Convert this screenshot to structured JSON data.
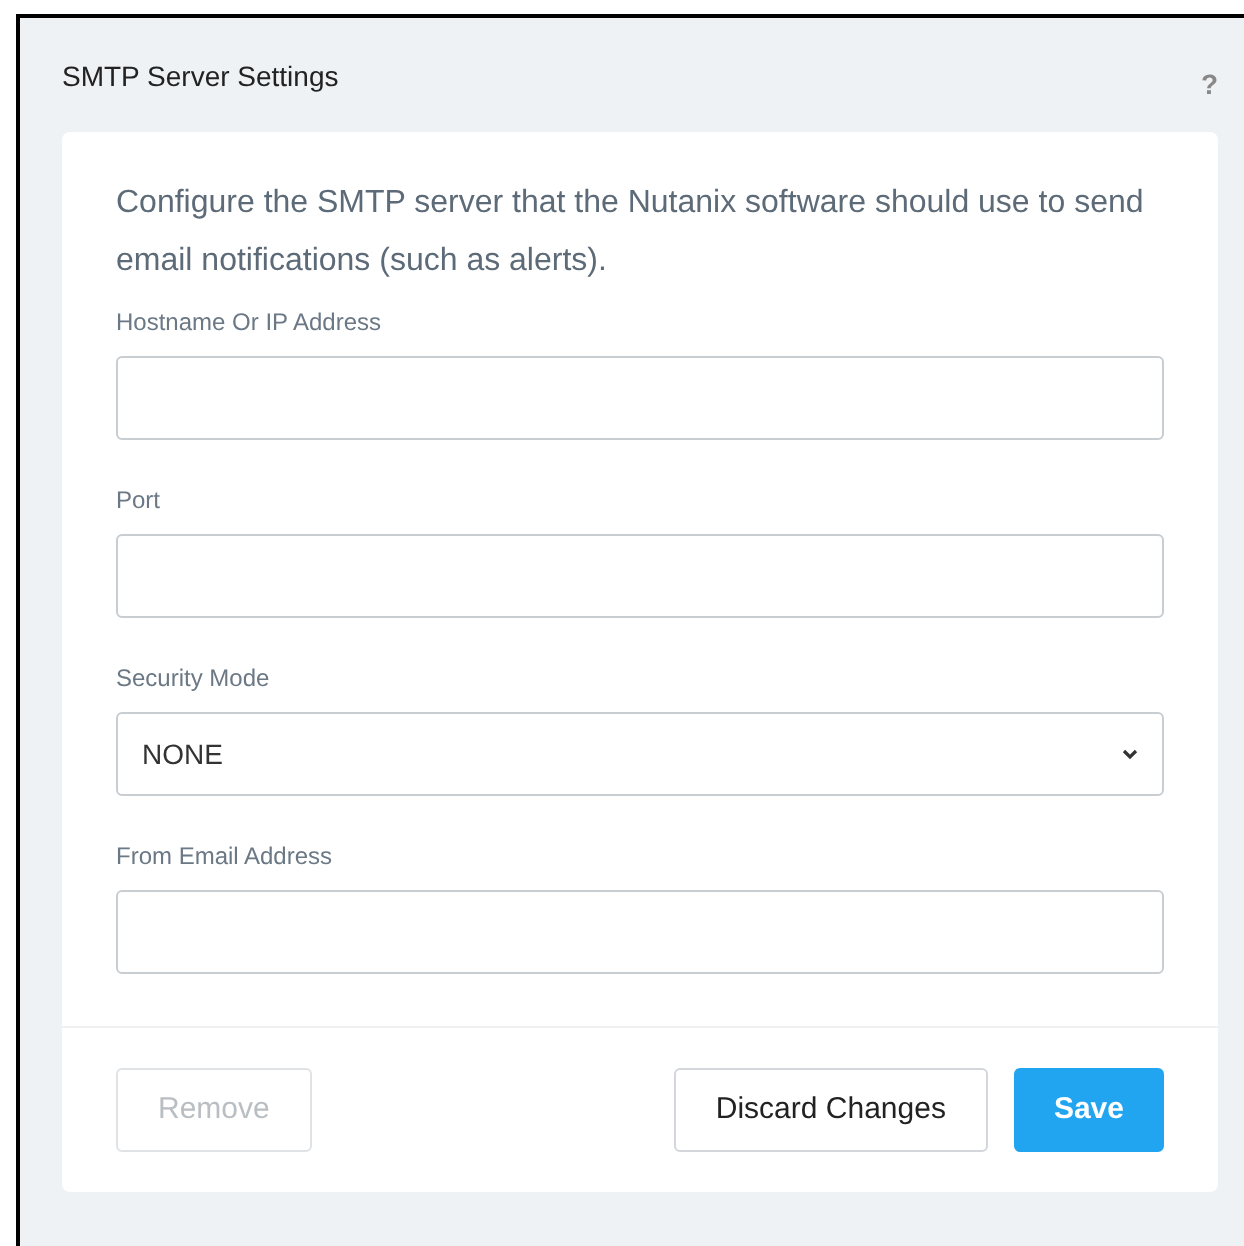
{
  "panel": {
    "title": "SMTP Server Settings",
    "help": "?"
  },
  "description": "Configure the SMTP server that the Nutanix software should use to send email notifications (such as alerts).",
  "fields": [
    {
      "kind": "text",
      "label": "Hostname Or IP Address"
    },
    {
      "kind": "text",
      "label": "Port"
    },
    {
      "kind": "select",
      "label": "Security Mode",
      "value": "NONE"
    },
    {
      "kind": "text",
      "label": "From Email Address"
    }
  ],
  "buttons": [
    {
      "label": "Remove",
      "kind": "secondary",
      "disabled": true
    },
    {
      "label": "Discard Changes",
      "kind": "secondary",
      "disabled": false
    },
    {
      "label": "Save",
      "kind": "primary",
      "disabled": false
    }
  ]
}
